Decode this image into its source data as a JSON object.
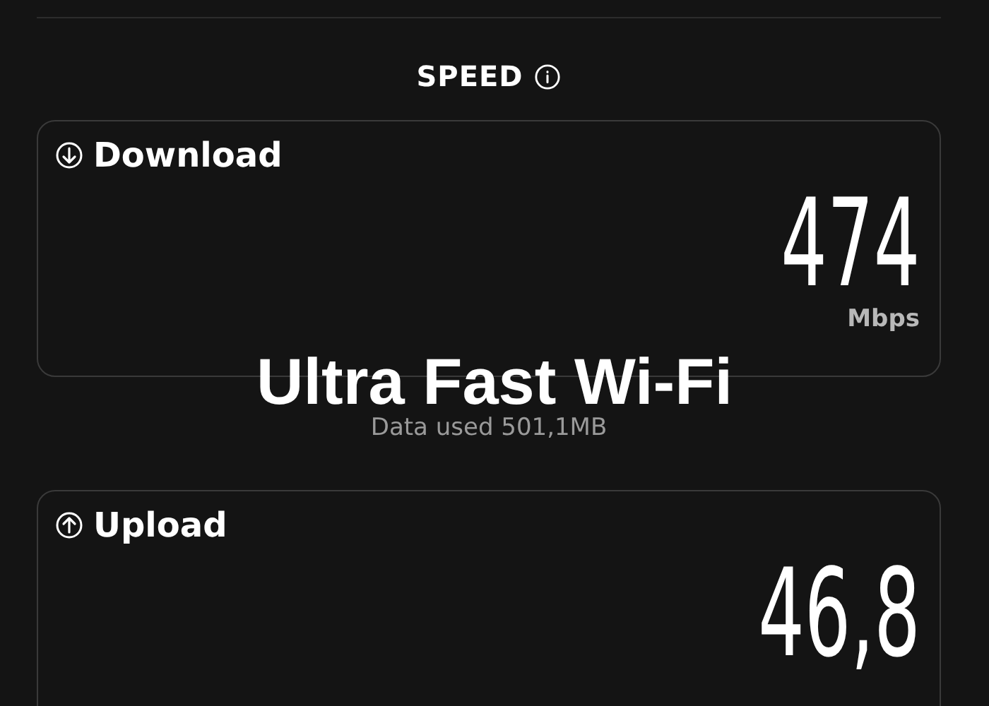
{
  "section": {
    "title": "SPEED"
  },
  "cards": [
    {
      "kind": "download",
      "label": "Download",
      "value": "474",
      "unit": "Mbps"
    },
    {
      "kind": "upload",
      "label": "Upload",
      "value": "46,8"
    }
  ],
  "data_used": "Data used 501,1MB",
  "caption": "Ultra Fast Wi-Fi"
}
